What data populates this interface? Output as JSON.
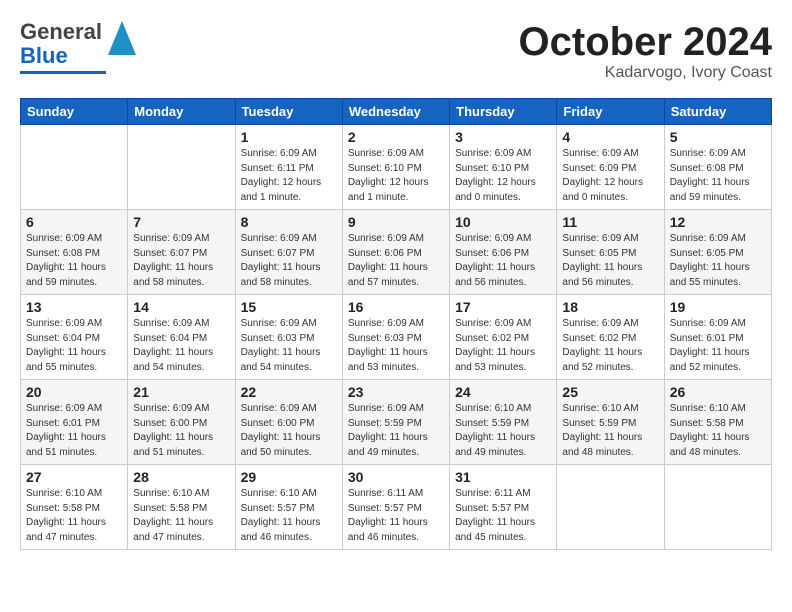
{
  "header": {
    "logo_general": "General",
    "logo_blue": "Blue",
    "month": "October 2024",
    "location": "Kadarvogo, Ivory Coast"
  },
  "days_of_week": [
    "Sunday",
    "Monday",
    "Tuesday",
    "Wednesday",
    "Thursday",
    "Friday",
    "Saturday"
  ],
  "weeks": [
    [
      {
        "day": "",
        "info": ""
      },
      {
        "day": "",
        "info": ""
      },
      {
        "day": "1",
        "info": "Sunrise: 6:09 AM\nSunset: 6:11 PM\nDaylight: 12 hours\nand 1 minute."
      },
      {
        "day": "2",
        "info": "Sunrise: 6:09 AM\nSunset: 6:10 PM\nDaylight: 12 hours\nand 1 minute."
      },
      {
        "day": "3",
        "info": "Sunrise: 6:09 AM\nSunset: 6:10 PM\nDaylight: 12 hours\nand 0 minutes."
      },
      {
        "day": "4",
        "info": "Sunrise: 6:09 AM\nSunset: 6:09 PM\nDaylight: 12 hours\nand 0 minutes."
      },
      {
        "day": "5",
        "info": "Sunrise: 6:09 AM\nSunset: 6:08 PM\nDaylight: 11 hours\nand 59 minutes."
      }
    ],
    [
      {
        "day": "6",
        "info": "Sunrise: 6:09 AM\nSunset: 6:08 PM\nDaylight: 11 hours\nand 59 minutes."
      },
      {
        "day": "7",
        "info": "Sunrise: 6:09 AM\nSunset: 6:07 PM\nDaylight: 11 hours\nand 58 minutes."
      },
      {
        "day": "8",
        "info": "Sunrise: 6:09 AM\nSunset: 6:07 PM\nDaylight: 11 hours\nand 58 minutes."
      },
      {
        "day": "9",
        "info": "Sunrise: 6:09 AM\nSunset: 6:06 PM\nDaylight: 11 hours\nand 57 minutes."
      },
      {
        "day": "10",
        "info": "Sunrise: 6:09 AM\nSunset: 6:06 PM\nDaylight: 11 hours\nand 56 minutes."
      },
      {
        "day": "11",
        "info": "Sunrise: 6:09 AM\nSunset: 6:05 PM\nDaylight: 11 hours\nand 56 minutes."
      },
      {
        "day": "12",
        "info": "Sunrise: 6:09 AM\nSunset: 6:05 PM\nDaylight: 11 hours\nand 55 minutes."
      }
    ],
    [
      {
        "day": "13",
        "info": "Sunrise: 6:09 AM\nSunset: 6:04 PM\nDaylight: 11 hours\nand 55 minutes."
      },
      {
        "day": "14",
        "info": "Sunrise: 6:09 AM\nSunset: 6:04 PM\nDaylight: 11 hours\nand 54 minutes."
      },
      {
        "day": "15",
        "info": "Sunrise: 6:09 AM\nSunset: 6:03 PM\nDaylight: 11 hours\nand 54 minutes."
      },
      {
        "day": "16",
        "info": "Sunrise: 6:09 AM\nSunset: 6:03 PM\nDaylight: 11 hours\nand 53 minutes."
      },
      {
        "day": "17",
        "info": "Sunrise: 6:09 AM\nSunset: 6:02 PM\nDaylight: 11 hours\nand 53 minutes."
      },
      {
        "day": "18",
        "info": "Sunrise: 6:09 AM\nSunset: 6:02 PM\nDaylight: 11 hours\nand 52 minutes."
      },
      {
        "day": "19",
        "info": "Sunrise: 6:09 AM\nSunset: 6:01 PM\nDaylight: 11 hours\nand 52 minutes."
      }
    ],
    [
      {
        "day": "20",
        "info": "Sunrise: 6:09 AM\nSunset: 6:01 PM\nDaylight: 11 hours\nand 51 minutes."
      },
      {
        "day": "21",
        "info": "Sunrise: 6:09 AM\nSunset: 6:00 PM\nDaylight: 11 hours\nand 51 minutes."
      },
      {
        "day": "22",
        "info": "Sunrise: 6:09 AM\nSunset: 6:00 PM\nDaylight: 11 hours\nand 50 minutes."
      },
      {
        "day": "23",
        "info": "Sunrise: 6:09 AM\nSunset: 5:59 PM\nDaylight: 11 hours\nand 49 minutes."
      },
      {
        "day": "24",
        "info": "Sunrise: 6:10 AM\nSunset: 5:59 PM\nDaylight: 11 hours\nand 49 minutes."
      },
      {
        "day": "25",
        "info": "Sunrise: 6:10 AM\nSunset: 5:59 PM\nDaylight: 11 hours\nand 48 minutes."
      },
      {
        "day": "26",
        "info": "Sunrise: 6:10 AM\nSunset: 5:58 PM\nDaylight: 11 hours\nand 48 minutes."
      }
    ],
    [
      {
        "day": "27",
        "info": "Sunrise: 6:10 AM\nSunset: 5:58 PM\nDaylight: 11 hours\nand 47 minutes."
      },
      {
        "day": "28",
        "info": "Sunrise: 6:10 AM\nSunset: 5:58 PM\nDaylight: 11 hours\nand 47 minutes."
      },
      {
        "day": "29",
        "info": "Sunrise: 6:10 AM\nSunset: 5:57 PM\nDaylight: 11 hours\nand 46 minutes."
      },
      {
        "day": "30",
        "info": "Sunrise: 6:11 AM\nSunset: 5:57 PM\nDaylight: 11 hours\nand 46 minutes."
      },
      {
        "day": "31",
        "info": "Sunrise: 6:11 AM\nSunset: 5:57 PM\nDaylight: 11 hours\nand 45 minutes."
      },
      {
        "day": "",
        "info": ""
      },
      {
        "day": "",
        "info": ""
      }
    ]
  ]
}
